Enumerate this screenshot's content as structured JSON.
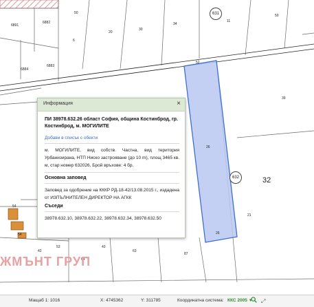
{
  "map": {
    "parcel_labels": [
      "6891",
      "6882",
      "50",
      "6884",
      "6883",
      "26",
      "54",
      "42",
      "43",
      "34",
      "54",
      "52",
      "53",
      "20",
      "30",
      "50",
      "63",
      "64",
      "87",
      "11",
      "6",
      "39",
      "21",
      "26"
    ],
    "circle_labels": [
      "631",
      "632"
    ],
    "big_label": "32",
    "watermark": "ЖМЪНТ ГРУП",
    "colors": {
      "selected_parcel_fill": "#b9c8f1",
      "selected_parcel_stroke": "#3c6fd0",
      "house_fill": "#d99038"
    }
  },
  "popup": {
    "title": "Информация",
    "close": "×",
    "parcel_title": "ПИ 38978.632.26 област София, община Костинброд, гр. Костинброд, м. МОГИЛИТЕ",
    "add_link": "Добави в списък с обекти",
    "description": "м. МОГИЛИТЕ, вид собств. Частна, вид територия Урбанизирана, НТП Ниско застрояване (до 10 m), площ 3465 кв. м, стар номер 632026, Брой връхове: 4 бр.",
    "order_title": "Основна заповед",
    "order_text": "Заповед за одобрение на КККР РД-18-42/13.08.2015 г., издадена от ИЗПЪЛНИТЕЛЕН ДИРЕКТОР НА АГКК",
    "neighbors_title": "Съседи",
    "neighbors_text": "38978.632.10, 38978.632.22, 38978.632.34, 38978.632.50"
  },
  "statusbar": {
    "scale": "Мащаб 1: 1016",
    "x": "X: 4745362",
    "y": "Y: 311785",
    "crs_label": "Координатна система:",
    "crs_value": "ККС 2005",
    "crs_arrow": "▼",
    "expand": "⤢"
  }
}
